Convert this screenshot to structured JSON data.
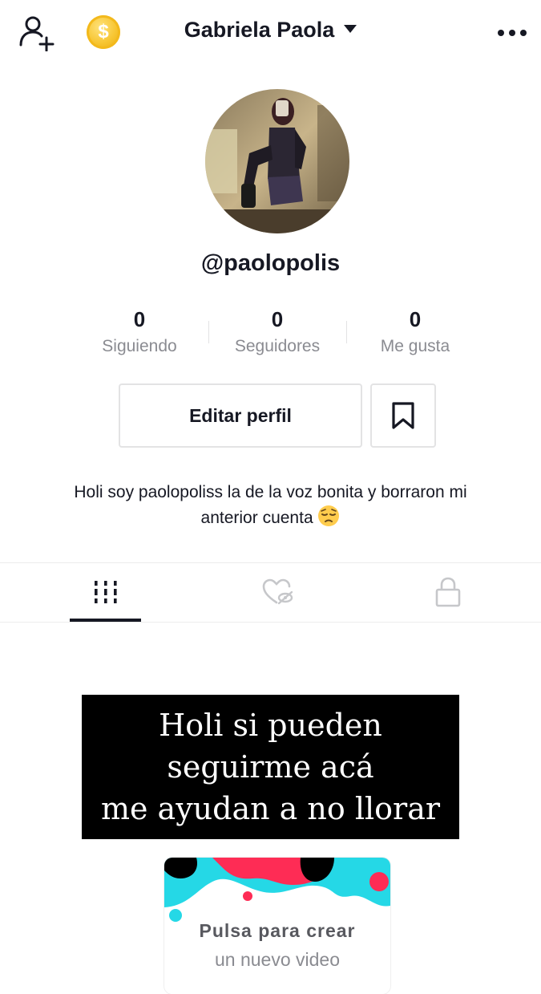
{
  "header": {
    "account_name": "Gabriela Paola",
    "coin_symbol": "$",
    "icons": {
      "add_user": "add-user-icon",
      "coin": "coin-icon",
      "caret": "chevron-down-icon",
      "more": "more-horizontal-icon"
    }
  },
  "profile": {
    "username": "@paolopolis",
    "stats": [
      {
        "value": "0",
        "label": "Siguiendo"
      },
      {
        "value": "0",
        "label": "Seguidores"
      },
      {
        "value": "0",
        "label": "Me gusta"
      }
    ],
    "edit_label": "Editar perfil",
    "bio_text": "Holi soy paolopoliss la de la voz bonita y borraron mi anterior cuenta",
    "bio_emoji": "pensive-face-emoji"
  },
  "tabs": [
    {
      "icon": "grid-icon",
      "active": true
    },
    {
      "icon": "hidden-liked-heart-icon",
      "active": false
    },
    {
      "icon": "lock-icon",
      "active": false
    }
  ],
  "overlay": {
    "lines": [
      "Holi si pueden",
      "seguirme acá",
      "me ayudan a no llorar"
    ]
  },
  "create_card": {
    "title": "Pulsa para crear",
    "subtitle": "un nuevo video"
  },
  "colors": {
    "text_primary": "#161823",
    "text_secondary": "#8a8b91",
    "border": "#e3e3e4",
    "tiktok_cyan": "#25d8e6",
    "tiktok_pink": "#fe2c55",
    "coin_gold": "#f7c531"
  }
}
